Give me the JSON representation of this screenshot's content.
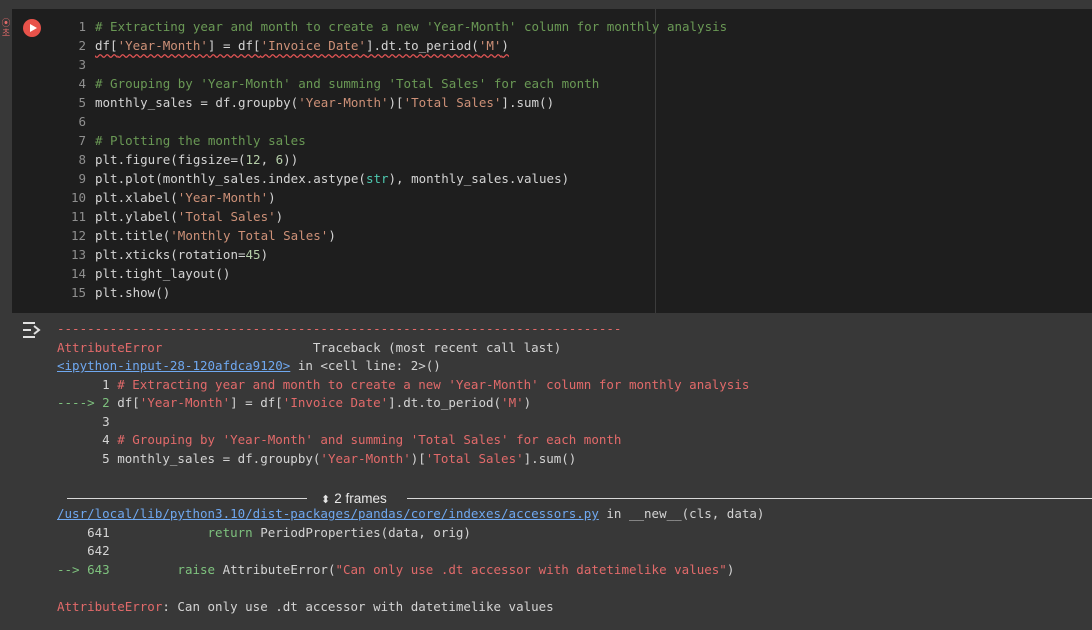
{
  "gutter": {
    "marker": "⦿\n초"
  },
  "cell": {
    "lines": [
      {
        "n": "1",
        "segs": [
          {
            "t": "# Extracting year and month to create a new 'Year-Month' column for monthly analysis",
            "c": "comment"
          }
        ]
      },
      {
        "n": "2",
        "segs": [
          {
            "t": "df[",
            "c": "",
            "sq": true
          },
          {
            "t": "'Year-Month'",
            "c": "str",
            "sq": true
          },
          {
            "t": "] = df[",
            "c": "",
            "sq": true
          },
          {
            "t": "'Invoice Date'",
            "c": "str",
            "sq": true
          },
          {
            "t": "].dt.to_period(",
            "c": "",
            "sq": true
          },
          {
            "t": "'M'",
            "c": "str",
            "sq": true
          },
          {
            "t": ")",
            "c": "",
            "sq": true
          }
        ]
      },
      {
        "n": "3",
        "segs": []
      },
      {
        "n": "4",
        "segs": [
          {
            "t": "# Grouping by 'Year-Month' and summing 'Total Sales' for each month",
            "c": "comment"
          }
        ]
      },
      {
        "n": "5",
        "segs": [
          {
            "t": "monthly_sales = df.groupby(",
            "c": ""
          },
          {
            "t": "'Year-Month'",
            "c": "str"
          },
          {
            "t": ")[",
            "c": ""
          },
          {
            "t": "'Total Sales'",
            "c": "str"
          },
          {
            "t": "].sum()",
            "c": ""
          }
        ]
      },
      {
        "n": "6",
        "segs": []
      },
      {
        "n": "7",
        "segs": [
          {
            "t": "# Plotting the monthly sales",
            "c": "comment"
          }
        ]
      },
      {
        "n": "8",
        "segs": [
          {
            "t": "plt.figure(figsize=(",
            "c": ""
          },
          {
            "t": "12",
            "c": "num"
          },
          {
            "t": ", ",
            "c": ""
          },
          {
            "t": "6",
            "c": "num"
          },
          {
            "t": "))",
            "c": ""
          }
        ]
      },
      {
        "n": "9",
        "segs": [
          {
            "t": "plt.plot(monthly_sales.index.astype(",
            "c": ""
          },
          {
            "t": "str",
            "c": "builtin"
          },
          {
            "t": "), monthly_sales.values)",
            "c": ""
          }
        ]
      },
      {
        "n": "10",
        "segs": [
          {
            "t": "plt.xlabel(",
            "c": ""
          },
          {
            "t": "'Year-Month'",
            "c": "str"
          },
          {
            "t": ")",
            "c": ""
          }
        ]
      },
      {
        "n": "11",
        "segs": [
          {
            "t": "plt.ylabel(",
            "c": ""
          },
          {
            "t": "'Total Sales'",
            "c": "str"
          },
          {
            "t": ")",
            "c": ""
          }
        ]
      },
      {
        "n": "12",
        "segs": [
          {
            "t": "plt.title(",
            "c": ""
          },
          {
            "t": "'Monthly Total Sales'",
            "c": "str"
          },
          {
            "t": ")",
            "c": ""
          }
        ]
      },
      {
        "n": "13",
        "segs": [
          {
            "t": "plt.xticks(rotation=",
            "c": ""
          },
          {
            "t": "45",
            "c": "num"
          },
          {
            "t": ")",
            "c": ""
          }
        ]
      },
      {
        "n": "14",
        "segs": [
          {
            "t": "plt.tight_layout()",
            "c": ""
          }
        ]
      },
      {
        "n": "15",
        "segs": [
          {
            "t": "plt.show()",
            "c": ""
          }
        ]
      }
    ]
  },
  "output": {
    "separator": "---------------------------------------------------------------------------",
    "error_name": "AttributeError",
    "traceback_label": "Traceback (most recent call last)",
    "link1": "<ipython-input-28-120afdca9120>",
    "link1_suffix": " in <cell line: 2>()",
    "trace1": [
      {
        "prefix": "      1 ",
        "segs": [
          {
            "t": "# Extracting year and month to create a new 'Year-Month' column for monthly analysis",
            "c": "red"
          }
        ]
      },
      {
        "prefix": "----> 2 ",
        "prefix_c": "green",
        "segs": [
          {
            "t": "df[",
            "c": ""
          },
          {
            "t": "'Year-Month'",
            "c": "red"
          },
          {
            "t": "] = df[",
            "c": ""
          },
          {
            "t": "'Invoice Date'",
            "c": "red"
          },
          {
            "t": "].dt.to_period(",
            "c": ""
          },
          {
            "t": "'M'",
            "c": "red"
          },
          {
            "t": ")",
            "c": ""
          }
        ]
      },
      {
        "prefix": "      3",
        "segs": []
      },
      {
        "prefix": "      4 ",
        "segs": [
          {
            "t": "# Grouping by 'Year-Month' and summing 'Total Sales' for each month",
            "c": "red"
          }
        ]
      },
      {
        "prefix": "      5 ",
        "segs": [
          {
            "t": "monthly_sales = df.groupby(",
            "c": ""
          },
          {
            "t": "'Year-Month'",
            "c": "red"
          },
          {
            "t": ")[",
            "c": ""
          },
          {
            "t": "'Total Sales'",
            "c": "red"
          },
          {
            "t": "].sum()",
            "c": ""
          }
        ]
      }
    ],
    "frames_label": "2 frames",
    "link2": "/usr/local/lib/python3.10/dist-packages/pandas/core/indexes/accessors.py",
    "link2_suffix": " in __new__(cls, data)",
    "trace2": [
      {
        "prefix": "    641 ",
        "segs": [
          {
            "t": "            return",
            "c": "green"
          },
          {
            "t": " PeriodProperties(data, orig)",
            "c": ""
          }
        ]
      },
      {
        "prefix": "    642",
        "segs": []
      },
      {
        "prefix": "--> 643 ",
        "prefix_c": "green",
        "segs": [
          {
            "t": "        raise",
            "c": "green"
          },
          {
            "t": " AttributeError(",
            "c": ""
          },
          {
            "t": "\"Can only use .dt accessor with datetimelike values\"",
            "c": "red"
          },
          {
            "t": ")",
            "c": ""
          }
        ]
      }
    ],
    "final_error_name": "AttributeError",
    "final_error_msg": ": Can only use .dt accessor with datetimelike values"
  },
  "colors": {
    "cell_bg": "#1e1e1e",
    "output_bg": "#383838",
    "run_button": "#e8524a",
    "comment": "#6a9955",
    "string": "#ce9178",
    "error_red": "#e26a6a",
    "link_blue": "#6fa8f0"
  },
  "icons": {
    "run": "play-circle-icon",
    "output": "output-toggle-icon",
    "frames": "chevron-up-down-icon"
  }
}
